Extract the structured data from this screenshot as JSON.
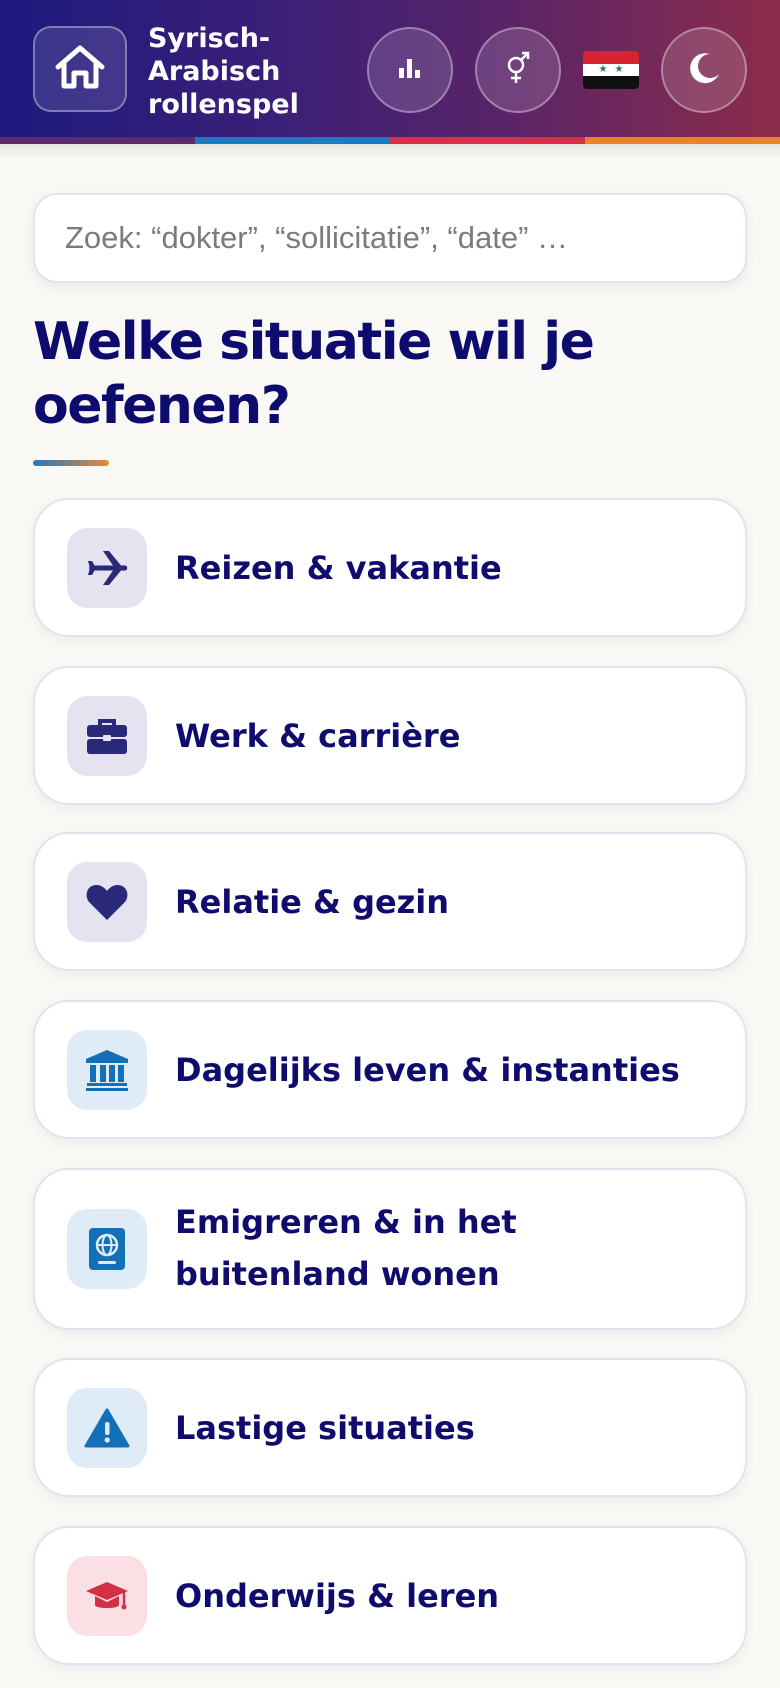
{
  "header": {
    "title": "Syrisch-\nArabisch\nrollenspel",
    "title_lines": [
      "Syrisch-",
      "Arabisch",
      "rollenspel"
    ],
    "icons": {
      "home": "home-icon",
      "stats": "bar-chart-icon",
      "gender": "gender-icon",
      "flag": "syria-flag-icon",
      "theme": "moon-icon"
    },
    "stripe_colors": [
      "#5b2a6e",
      "#1f78c2",
      "#d6304a",
      "#e8822f"
    ]
  },
  "search": {
    "placeholder": "Zoek: “dokter”, “sollicitatie”, “date” …",
    "value": ""
  },
  "main": {
    "heading": "Welke situatie wil je oefenen?",
    "categories": [
      {
        "label": "Reizen & vakantie",
        "icon": "airplane-icon",
        "icon_color": "#2a2878",
        "tile_color": "#e4e3ef"
      },
      {
        "label": "Werk & carrière",
        "icon": "briefcase-icon",
        "icon_color": "#2a2878",
        "tile_color": "#e4e3ef"
      },
      {
        "label": "Relatie & gezin",
        "icon": "heart-icon",
        "icon_color": "#2a2878",
        "tile_color": "#e4e3ef"
      },
      {
        "label": "Dagelijks leven & instanties",
        "icon": "bank-icon",
        "icon_color": "#1270b8",
        "tile_color": "#dfebf6"
      },
      {
        "label": "Emigreren & in het buitenland wonen",
        "icon": "passport-icon",
        "icon_color": "#1270b8",
        "tile_color": "#dfebf6"
      },
      {
        "label": "Lastige situaties",
        "icon": "warning-icon",
        "icon_color": "#1270b8",
        "tile_color": "#dfebf6"
      },
      {
        "label": "Onderwijs & leren",
        "icon": "graduation-cap-icon",
        "icon_color": "#d32f45",
        "tile_color": "#fae0e4"
      }
    ]
  }
}
